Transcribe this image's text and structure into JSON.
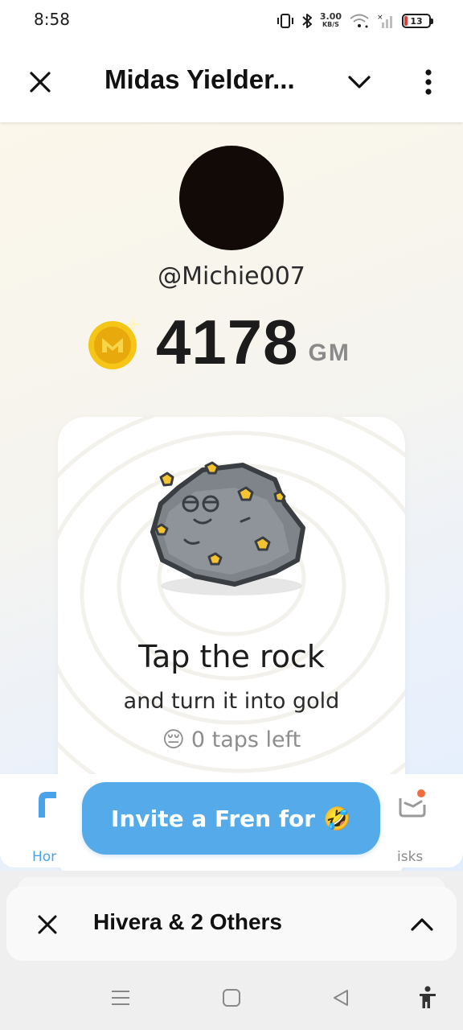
{
  "status_bar": {
    "time": "8:58",
    "net_speed_value": "3.00",
    "net_speed_unit": "KB/S",
    "battery_level": "13",
    "icons": [
      "vibrate-icon",
      "bluetooth-icon",
      "wifi-icon",
      "signal-icon",
      "battery-icon"
    ]
  },
  "header": {
    "title": "Midas Yielder...",
    "icons": [
      "close-icon",
      "chevron-down-icon",
      "more-vertical-icon"
    ]
  },
  "profile": {
    "username": "@Michie007",
    "balance": "4178",
    "unit": "GM"
  },
  "card": {
    "title": "Tap the rock",
    "subtitle": "and turn it into gold",
    "taps_emoji": "😔",
    "taps_left": "0 taps left"
  },
  "invite": {
    "label": "Invite a Fren for",
    "emoji": "🤣"
  },
  "bottom_nav": {
    "home_label": "Hor",
    "tasks_label": "isks",
    "accent": "#4aa3e8",
    "notification_dot": "#f26b3a"
  },
  "switcher": {
    "title": "Hivera & 2 Others"
  },
  "colors": {
    "invite_button": "#55aaea",
    "coin_gold": "#f5c518"
  }
}
